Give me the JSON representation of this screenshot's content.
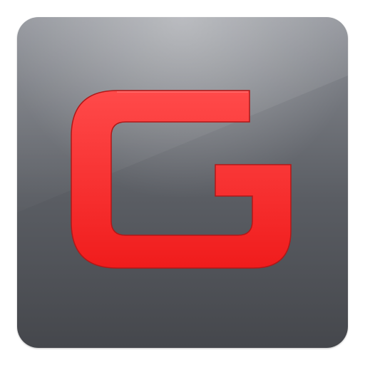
{
  "icon": {
    "name": "G app icon",
    "glyph": "letter-g-icon",
    "colors": {
      "tile_top": "#8a8d94",
      "tile_mid": "#5a5d63",
      "tile_bottom": "#45474c",
      "glyph_fill": "#ff2a2a",
      "glyph_edge": "#b01818",
      "page_background": "#ffffff"
    }
  }
}
